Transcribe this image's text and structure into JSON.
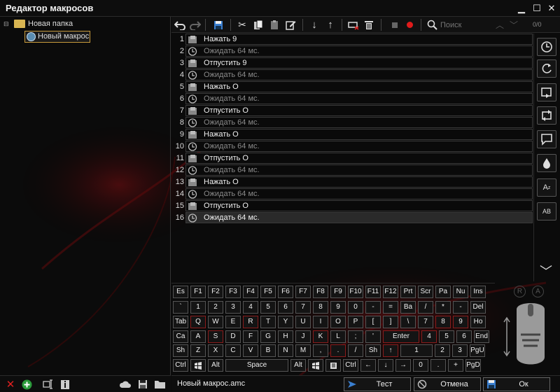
{
  "window": {
    "title": "Редактор макросов"
  },
  "tree": {
    "folder": "Новая папка",
    "macro": "Новый макрос"
  },
  "toolbar": {
    "search_placeholder": "Поиск",
    "counter": "0/0"
  },
  "commands": [
    {
      "num": "1",
      "text": "Нажать 9",
      "type": "key"
    },
    {
      "num": "2",
      "text": "Ожидать 64 мс.",
      "type": "wait"
    },
    {
      "num": "3",
      "text": "Отпустить 9",
      "type": "key"
    },
    {
      "num": "4",
      "text": "Ожидать 64 мс.",
      "type": "wait"
    },
    {
      "num": "5",
      "text": "Нажать O",
      "type": "key"
    },
    {
      "num": "6",
      "text": "Ожидать 64 мс.",
      "type": "wait"
    },
    {
      "num": "7",
      "text": "Отпустить O",
      "type": "key"
    },
    {
      "num": "8",
      "text": "Ожидать 64 мс.",
      "type": "wait"
    },
    {
      "num": "9",
      "text": "Нажать O",
      "type": "key"
    },
    {
      "num": "10",
      "text": "Ожидать 64 мс.",
      "type": "wait"
    },
    {
      "num": "11",
      "text": "Отпустить O",
      "type": "key"
    },
    {
      "num": "12",
      "text": "Ожидать 64 мс.",
      "type": "wait"
    },
    {
      "num": "13",
      "text": "Нажать O",
      "type": "key"
    },
    {
      "num": "14",
      "text": "Ожидать 64 мс.",
      "type": "wait"
    },
    {
      "num": "15",
      "text": "Отпустить O",
      "type": "key"
    },
    {
      "num": "16",
      "text": "Ожидать 64 мс.",
      "type": "wait",
      "selected": true
    }
  ],
  "keyboard": {
    "row1": [
      "Es",
      "F1",
      "F2",
      "F3",
      "F4",
      "F5",
      "F6",
      "F7",
      "F8",
      "F9",
      "F10",
      "F11",
      "F12",
      "Prt",
      "Scr",
      "Pa",
      "Nu",
      "Ins"
    ],
    "row2": [
      "`",
      "1",
      "2",
      "3",
      "4",
      "5",
      "6",
      "7",
      "8",
      "9",
      "0",
      "-",
      "=",
      "Ba",
      "/",
      "*",
      "-",
      "Del"
    ],
    "row3": [
      "Tab",
      "Q",
      "W",
      "E",
      "R",
      "T",
      "Y",
      "U",
      "I",
      "O",
      "P",
      "[",
      "]",
      "\\",
      "7",
      "8",
      "9",
      "Ho"
    ],
    "row4": [
      "Ca",
      "A",
      "S",
      "D",
      "F",
      "G",
      "H",
      "J",
      "K",
      "L",
      ";",
      "'",
      "Enter",
      "4",
      "5",
      "6",
      "End"
    ],
    "row5": [
      "Sh",
      "Z",
      "X",
      "C",
      "V",
      "B",
      "N",
      "M",
      ",",
      ".",
      "/",
      "Sh",
      "↑",
      "1",
      "2",
      "3",
      "PgU"
    ],
    "row6": [
      "Ctrl",
      "",
      "Alt",
      "Space",
      "Alt",
      "",
      "",
      "Ctrl",
      "←",
      "↓",
      "→",
      "0",
      ".",
      "+",
      "PgD"
    ]
  },
  "footer": {
    "filename": "Новый макрос.amc",
    "test_label": "Тест",
    "cancel_label": "Отмена",
    "ok_label": "Ок"
  },
  "colors": {
    "accent": "#c0151a",
    "selected_row": "#2a2a2a",
    "wait_text": "#8a8a8a"
  }
}
